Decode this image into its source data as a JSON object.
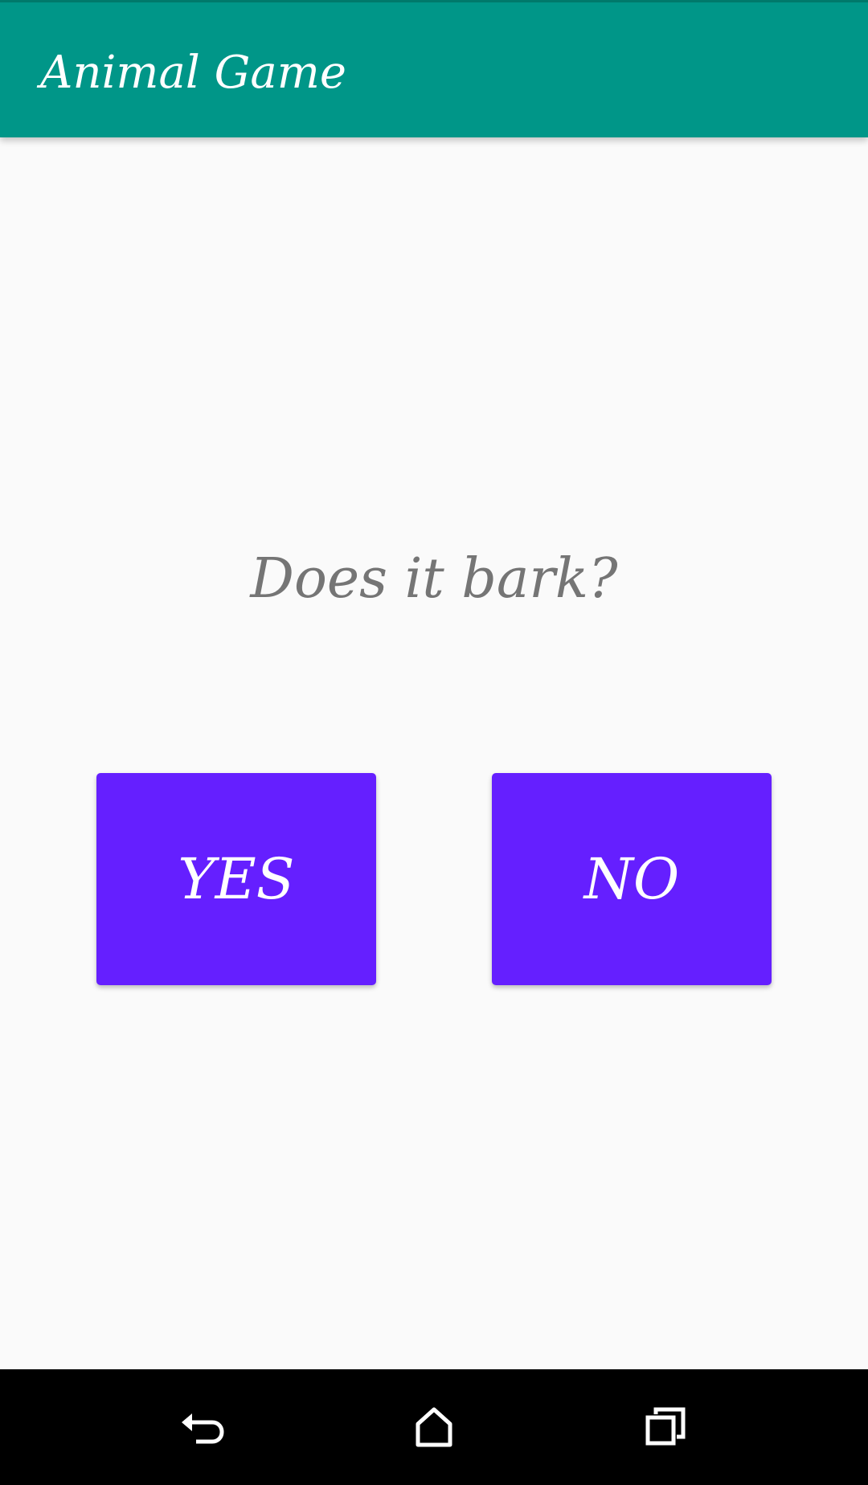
{
  "app_bar": {
    "title": "Animal Game",
    "background_color": "#009688"
  },
  "main": {
    "question": "Does it bark?",
    "yes_label": "YES",
    "no_label": "NO",
    "button_color": "#651fff",
    "question_color": "#757575"
  },
  "nav_bar": {
    "icons": [
      "back-icon",
      "home-icon",
      "recents-icon"
    ]
  }
}
